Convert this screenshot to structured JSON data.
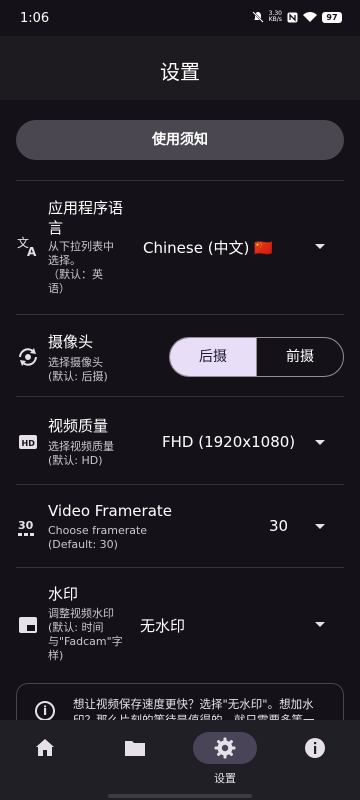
{
  "status": {
    "time": "1:06",
    "net_speed_value": "3.30",
    "net_speed_unit": "KB/s",
    "battery": "97"
  },
  "header": {
    "title": "设置"
  },
  "notice_button": {
    "label": "使用须知"
  },
  "language": {
    "title_line1": "应用程序语",
    "title_line2": "言",
    "desc": [
      "从下拉列表中",
      "选择。",
      "（默认：英",
      "语）"
    ],
    "value": "Chinese (中文) 🇨🇳",
    "icon": "translate-icon"
  },
  "camera": {
    "title": "摄像头",
    "desc": [
      "选择摄像头",
      "(默认: 后摄)"
    ],
    "options": [
      "后摄",
      "前摄"
    ],
    "selected": "后摄",
    "icon": "camera-switch-icon"
  },
  "video_quality": {
    "title": "视频质量",
    "desc": [
      "选择视频质量",
      "(默认: HD)"
    ],
    "value": "FHD (1920x1080)",
    "icon": "hd-icon"
  },
  "framerate": {
    "title": "Video Framerate",
    "desc": [
      "Choose framerate",
      "(Default: 30)"
    ],
    "value": "30",
    "icon": "framerate-30-icon"
  },
  "watermark": {
    "title": "水印",
    "desc": [
      "调整视频水印",
      "(默认: 时间",
      "与\"Fadcam\"字",
      "样)"
    ],
    "value": "无水印",
    "icon": "watermark-icon"
  },
  "info_card": {
    "lines": [
      "想让视频保存速度更快？选择\"无水印\"。想加水",
      "印？那么片刻的等待是值得的，就只需要多等一"
    ]
  },
  "bottom_nav": {
    "items": [
      {
        "icon": "home-icon",
        "label": ""
      },
      {
        "icon": "folder-icon",
        "label": ""
      },
      {
        "icon": "gear-icon",
        "label": "设置"
      },
      {
        "icon": "info-icon",
        "label": ""
      }
    ],
    "active_index": 2
  }
}
